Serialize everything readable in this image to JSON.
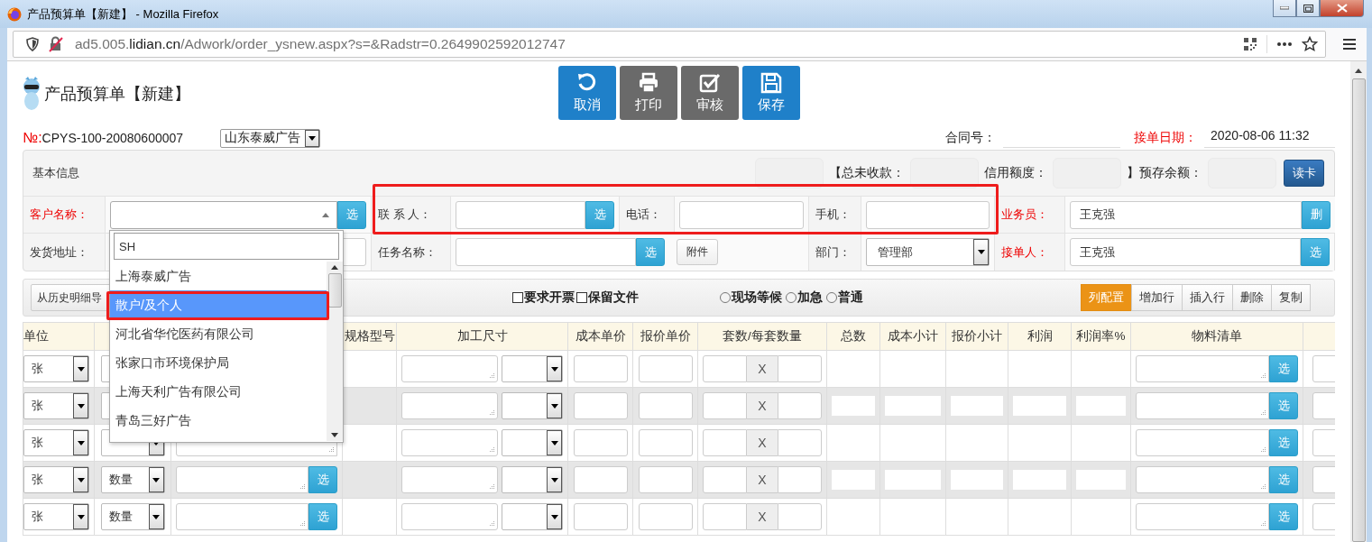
{
  "window": {
    "title": "产品预算单【新建】 - Mozilla Firefox"
  },
  "browser": {
    "url": "ad5.005.**lidian.cn**/Adwork/order_ysnew.aspx?s=&Radstr=0.2649902592012747"
  },
  "page": {
    "title": "产品预算单【新建】",
    "toolbar": [
      {
        "label": "取消",
        "color": "#1f80c9"
      },
      {
        "label": "打印",
        "color": "#6a6a6a"
      },
      {
        "label": "审核",
        "color": "#6a6a6a"
      },
      {
        "label": "保存",
        "color": "#1f80c9"
      }
    ]
  },
  "doc": {
    "no_mark": "№:",
    "no": "CPYS-100-20080600007",
    "company": "山东泰威广告",
    "contract_label": "合同号：",
    "date_label": "接单日期：",
    "date": "2020-08-06 11:32"
  },
  "info_bar": {
    "title": "基本信息",
    "fields": [
      "【总未收款：",
      "信用额度：",
      "】预存余额："
    ],
    "button": "读卡"
  },
  "form": {
    "rows": [
      {
        "fields": [
          {
            "label": "客户名称：",
            "kind": "combo",
            "required": true,
            "button": "选",
            "open": true,
            "dropdown": {
              "search": "SH",
              "items": [
                {
                  "text": "上海泰威广告",
                  "selected": false
                },
                {
                  "text": "散户/及个人",
                  "selected": true
                },
                {
                  "text": "河北省华佗医药有限公司",
                  "selected": false
                },
                {
                  "text": "张家口市环境保护局",
                  "selected": false
                },
                {
                  "text": "上海天利广告有限公司",
                  "selected": false
                },
                {
                  "text": "青岛三好广告",
                  "selected": false
                }
              ]
            }
          },
          {
            "label": "联 系 人：",
            "kind": "input_button",
            "required": false,
            "button": "选"
          },
          {
            "label": "电话：",
            "kind": "input",
            "required": false
          },
          {
            "label": "手机：",
            "kind": "input",
            "required": false
          },
          {
            "label": "业务员：",
            "kind": "input_button",
            "required": true,
            "value": "王克强",
            "button": "删"
          }
        ]
      },
      {
        "fields": [
          {
            "label": "发货地址：",
            "kind": "input",
            "required": false
          },
          {
            "label": "任务名称：",
            "kind": "input_button",
            "required": false,
            "button": "选",
            "extra_button": "附件"
          },
          {
            "label": "部门：",
            "kind": "select",
            "required": false,
            "value": "管理部"
          },
          {
            "label": "接单人：",
            "kind": "input_button",
            "required": true,
            "value": "王克强",
            "button": "选"
          }
        ]
      }
    ]
  },
  "list_bar": {
    "import_button": "从历史明细导",
    "checkboxes": [
      {
        "label": "要求开票",
        "checked": false
      },
      {
        "label": "保留文件",
        "checked": false
      }
    ],
    "radios": [
      {
        "label": "现场等候",
        "selected": false
      },
      {
        "label": "加急",
        "selected": false
      },
      {
        "label": "普通",
        "selected": false
      }
    ],
    "actions": [
      {
        "label": "列配置",
        "active": true
      },
      {
        "label": "增加行",
        "active": false
      },
      {
        "label": "插入行",
        "active": false
      },
      {
        "label": "删除",
        "active": false
      },
      {
        "label": "复制",
        "active": false
      }
    ]
  },
  "table": {
    "columns": [
      "单位",
      "规格型号",
      "加工尺寸",
      "成本单价",
      "报价单价",
      "套数/每套数量",
      "总数",
      "成本小计",
      "报价小计",
      "利润",
      "利润率%",
      "物料清单"
    ],
    "rows": [
      {
        "unit": "张",
        "times": "X",
        "bom_button": "选",
        "shaded": false
      },
      {
        "unit": "张",
        "times": "X",
        "bom_button": "选",
        "shaded": true
      },
      {
        "unit": "张",
        "times": "X",
        "bom_button": "选",
        "shaded": false
      },
      {
        "unit": "张",
        "measure": "数量",
        "spec_button": "选",
        "times": "X",
        "bom_button": "选",
        "shaded": true
      },
      {
        "unit": "张",
        "measure": "数量",
        "spec_button": "选",
        "times": "X",
        "bom_button": "选",
        "shaded": false
      }
    ]
  },
  "annotations": [
    {
      "kind": "frame"
    },
    {
      "kind": "frame"
    }
  ]
}
